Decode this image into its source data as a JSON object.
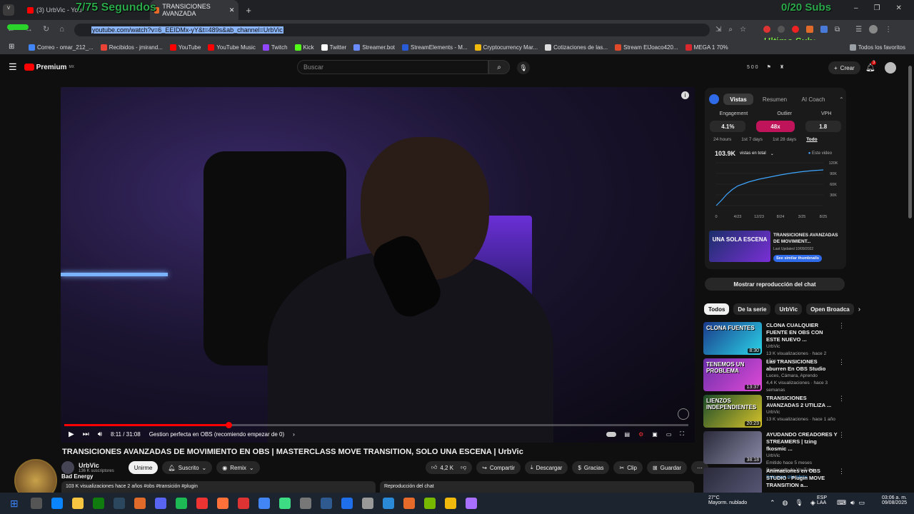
{
  "browser": {
    "tabs": [
      {
        "label": "(3) UrbVic - You",
        "active": false
      },
      {
        "label": "TRANSICIONES AVANZADA",
        "active": true
      }
    ],
    "overlay_counter": "7/75 Segundos",
    "overlay_subs": "0/20 Subs",
    "overlay_last": "Ultimo Sub:",
    "url_selected": "youtube.com/watch?v=6_EEIDMx-yY&t=489s&ab_channel=UrbVic",
    "bookmarks": [
      "Correo - omar_212_...",
      "Recibidos - jmirand...",
      "YouTube",
      "YouTube Music",
      "Twitch",
      "Kick",
      "Twitter",
      "Streamer.bot",
      "StreamElements - M...",
      "Cryptocurrency Mar...",
      "Cotizaciones de las...",
      "Stream ElJoaco420...",
      "MEGA 1 70%",
      "Todos los favoritos"
    ],
    "bookmark_colors": [
      "#4285f4",
      "#ea4335",
      "#ff0000",
      "#ff0000",
      "#9146ff",
      "#53fc18",
      "#ffffff",
      "#6a8cff",
      "#2a5bd7",
      "#f0b90b",
      "#dddddd",
      "#e04a2a",
      "#d9272e",
      "#9aa0a6"
    ]
  },
  "youtube": {
    "logo_text": "Premium",
    "logo_badge": "MX",
    "search_placeholder": "Buscar",
    "header_stats": "5  0  0",
    "create_label": "Crear",
    "notif_count": "3"
  },
  "video": {
    "time": "8:11 / 31:08",
    "chapter": "Gestion perfecta en OBS (recomiendo empezar de 0)",
    "progress": 0.263,
    "title": "TRANSICIONES AVANZADAS DE MOVIMIENTO EN OBS | MASTERCLASS MOVE TRANSITION, SOLO UNA ESCENA | UrbVic",
    "channel": "UrbVic",
    "subscribers": "136 K suscriptores",
    "join_label": "Unirme",
    "subscribed_label": "Suscrito",
    "remix_label": "Remix",
    "likes": "4,2 K",
    "share_label": "Compartir",
    "download_label": "Descargar",
    "thanks_label": "Gracias",
    "clip_label": "Clip",
    "save_label": "Guardar",
    "views_line": "103 K visualizaciones  hace 2 años  #obs #transición #plugin",
    "chat_replay_label": "Reproducción del chat",
    "overlay_song": "Bad Energy"
  },
  "panel": {
    "tabs": [
      "Vistas",
      "Resumen",
      "AI Coach"
    ],
    "metrics": [
      {
        "label": "Engagement",
        "value": "4.1%"
      },
      {
        "label": "Outlier",
        "value": "48x"
      },
      {
        "label": "VPH",
        "value": "1.8"
      }
    ],
    "ranges": [
      "24 hours",
      "1st 7 days",
      "1st 28 days",
      "Todo"
    ],
    "total_views": "103.9K",
    "views_label": "vistas en total",
    "legend": "Este video",
    "promo_title": "TRANSICIONES AVANZADAS DE MOVIMIENT...",
    "promo_updated": "Last Updated 10/09/2022",
    "promo_button": "See similar thumbnails",
    "thumb_text": "UNA SOLA ESCENA"
  },
  "chart_data": {
    "type": "line",
    "x_ticks": [
      "0",
      "4/23",
      "12/23",
      "8/24",
      "3/25",
      "8/25"
    ],
    "y_ticks": [
      "0",
      "30K",
      "60K",
      "90K",
      "120K"
    ],
    "ylim": [
      0,
      120000
    ],
    "series": [
      {
        "name": "Este video",
        "x": [
          0,
          0.05,
          0.1,
          0.15,
          0.2,
          0.3,
          0.4,
          0.5,
          0.6,
          0.7,
          0.8,
          0.9,
          1.0
        ],
        "values": [
          0,
          15000,
          32000,
          45000,
          55000,
          66000,
          74000,
          80000,
          86000,
          91000,
          95000,
          98000,
          100000
        ]
      }
    ]
  },
  "chat_button": "Mostrar reproducción del chat",
  "chips": [
    "Todos",
    "De la serie",
    "UrbVic",
    "Open Broadca"
  ],
  "recommendations": [
    {
      "title": "CLONA CUALQUIER FUENTE EN OBS CON ESTE NUEVO ...",
      "channel": "UrbVic",
      "meta": "13 K visualizaciones · hace 2 años",
      "duration": "8:30",
      "thumb_text": "CLONA FUENTES"
    },
    {
      "title": "Las TRANSICIONES aburren En OBS Studio",
      "channel": "Luces, Cámara, Aprendo",
      "meta": "4,4 K visualizaciones · hace 3 semanas",
      "duration": "13:37",
      "thumb_text": "TENEMOS UN PROBLEMA"
    },
    {
      "title": "TRANSICIONES AVANZADAS 2 UTILIZA ...",
      "channel": "UrbVic",
      "meta": "13 K visualizaciones · hace 1 año",
      "duration": "20:23",
      "thumb_text": "LIENZOS INDEPENDIENTES"
    },
    {
      "title": "AYUDANDO CREADORES Y STREAMERS | tzing fkosmic ...",
      "channel": "UrbVic",
      "meta": "Emitido hace 5 meses",
      "duration": "38:18",
      "badge": "Destacado de YouTube",
      "badge2": "Solo para miembros"
    },
    {
      "title": "Animaciones en OBS STUDIO - Plugin MOVE TRANSITION a...",
      "channel": "",
      "meta": "",
      "duration": "",
      "thumb_text": ""
    }
  ],
  "taskbar": {
    "weather_temp": "27°C",
    "weather_desc": "Mayorm. nublado",
    "lang": "ESP",
    "lang2": "LAA",
    "time": "03:06 a. m.",
    "date": "09/08/2025"
  }
}
